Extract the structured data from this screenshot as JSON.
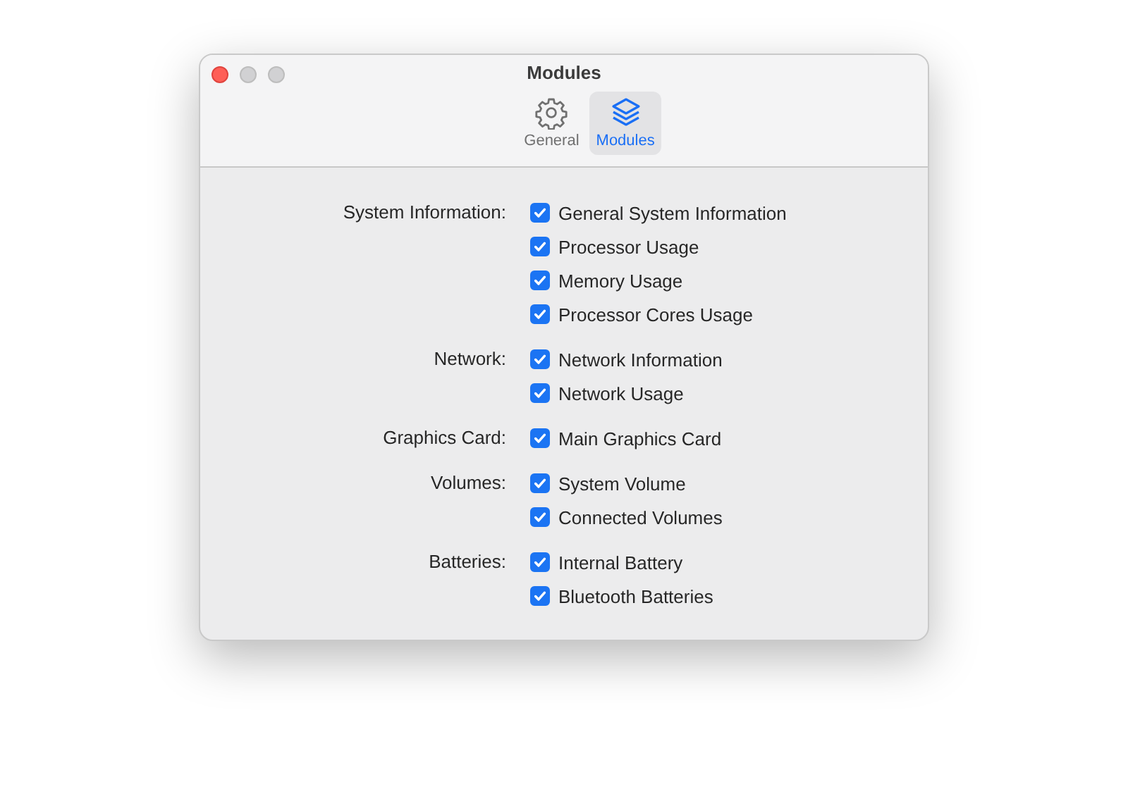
{
  "window": {
    "title": "Modules"
  },
  "tabs": [
    {
      "label": "General",
      "kind": "gear",
      "selected": false
    },
    {
      "label": "Modules",
      "kind": "layers",
      "selected": true
    }
  ],
  "groups": [
    {
      "label": "System Information:",
      "options": [
        {
          "label": "General System Information",
          "checked": true
        },
        {
          "label": "Processor Usage",
          "checked": true
        },
        {
          "label": "Memory Usage",
          "checked": true
        },
        {
          "label": "Processor Cores Usage",
          "checked": true
        }
      ]
    },
    {
      "label": "Network:",
      "options": [
        {
          "label": "Network Information",
          "checked": true
        },
        {
          "label": "Network Usage",
          "checked": true
        }
      ]
    },
    {
      "label": "Graphics Card:",
      "options": [
        {
          "label": "Main Graphics Card",
          "checked": true
        }
      ]
    },
    {
      "label": "Volumes:",
      "options": [
        {
          "label": "System Volume",
          "checked": true
        },
        {
          "label": "Connected Volumes",
          "checked": true
        }
      ]
    },
    {
      "label": "Batteries:",
      "options": [
        {
          "label": "Internal Battery",
          "checked": true
        },
        {
          "label": "Bluetooth Batteries",
          "checked": true
        }
      ]
    }
  ]
}
